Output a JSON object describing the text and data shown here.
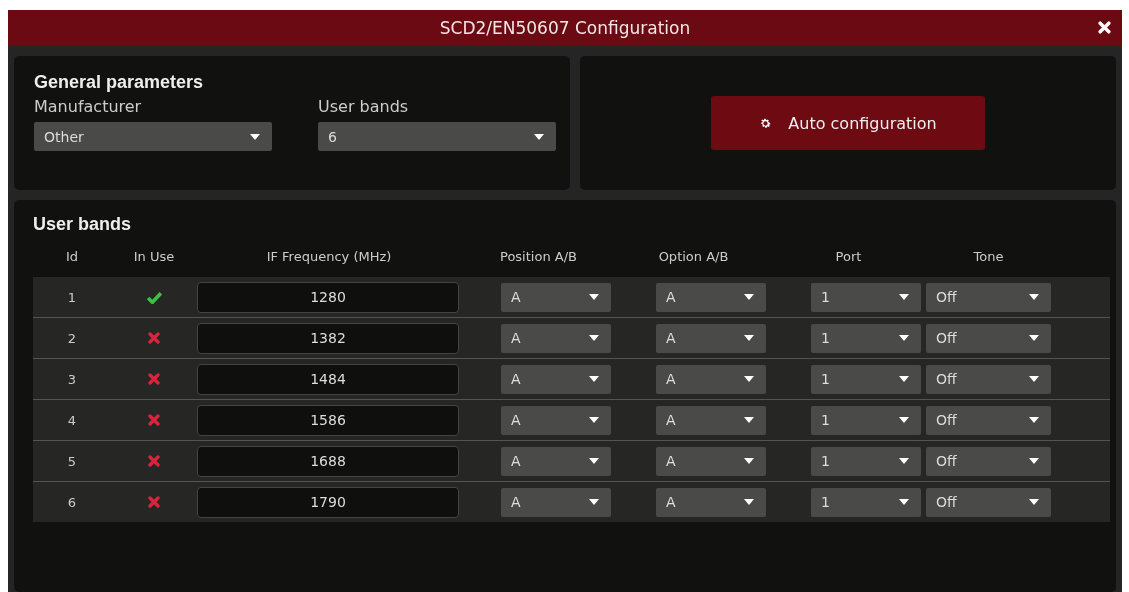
{
  "window": {
    "title": "SCD2/EN50607 Configuration"
  },
  "general": {
    "title": "General parameters",
    "fields": [
      {
        "label": "Manufacturer",
        "value": "Other"
      },
      {
        "label": "User bands",
        "value": "6"
      }
    ]
  },
  "auto_button": {
    "label": "Auto configuration"
  },
  "user_bands": {
    "title": "User bands",
    "columns": [
      "Id",
      "In Use",
      "IF Frequency (MHz)",
      "Position A/B",
      "Option A/B",
      "Port",
      "Tone"
    ],
    "rows": [
      {
        "id": "1",
        "in_use": true,
        "frequency": "1280",
        "position": "A",
        "option": "A",
        "port": "1",
        "tone": "Off"
      },
      {
        "id": "2",
        "in_use": false,
        "frequency": "1382",
        "position": "A",
        "option": "A",
        "port": "1",
        "tone": "Off"
      },
      {
        "id": "3",
        "in_use": false,
        "frequency": "1484",
        "position": "A",
        "option": "A",
        "port": "1",
        "tone": "Off"
      },
      {
        "id": "4",
        "in_use": false,
        "frequency": "1586",
        "position": "A",
        "option": "A",
        "port": "1",
        "tone": "Off"
      },
      {
        "id": "5",
        "in_use": false,
        "frequency": "1688",
        "position": "A",
        "option": "A",
        "port": "1",
        "tone": "Off"
      },
      {
        "id": "6",
        "in_use": false,
        "frequency": "1790",
        "position": "A",
        "option": "A",
        "port": "1",
        "tone": "Off"
      }
    ]
  }
}
